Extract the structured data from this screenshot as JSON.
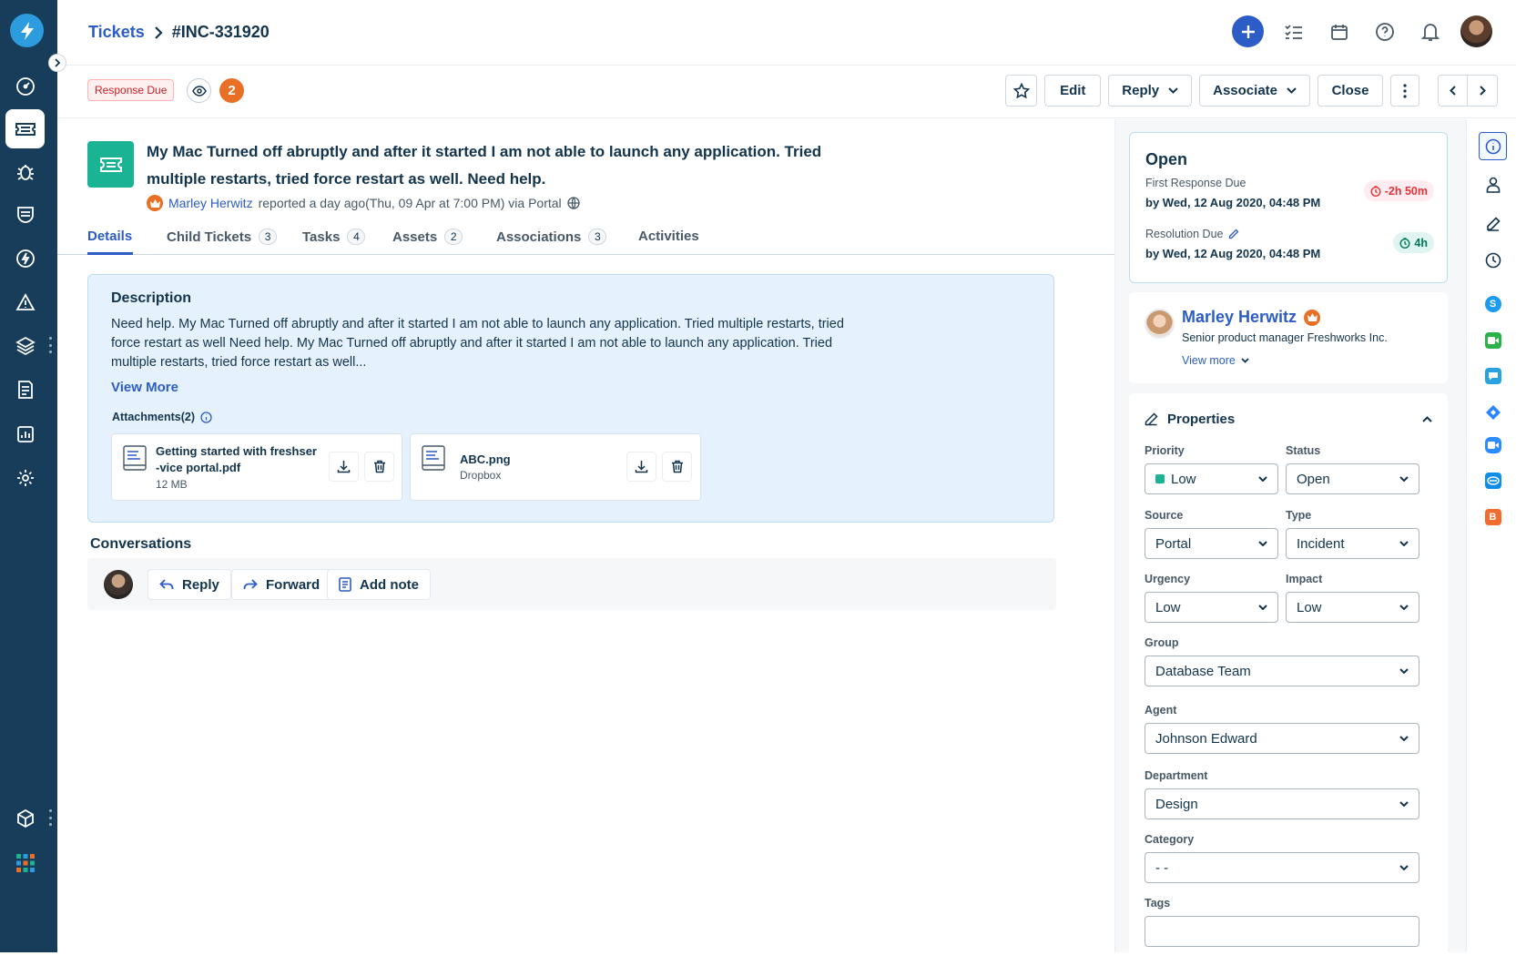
{
  "colors": {
    "brand": "#2c5cc5",
    "sidebar": "#173d5a",
    "ticket_icon": "#1ab394",
    "badge": "#e86f25",
    "due": "#c82124"
  },
  "breadcrumb": {
    "parent": "Tickets",
    "current": "#INC-331920"
  },
  "topbar": {
    "icons": [
      "add-icon",
      "todo-icon",
      "calendar-icon",
      "help-icon",
      "bell-icon",
      "avatar"
    ]
  },
  "status_bar": {
    "due_badge": "Response Due",
    "watchers_count": "2"
  },
  "actions": {
    "edit": "Edit",
    "reply": "Reply",
    "associate": "Associate",
    "close": "Close"
  },
  "ticket": {
    "subject": "My Mac Turned off abruptly and after it started I am not able to launch any application. Tried multiple restarts, tried force restart as well. Need help.",
    "requester": "Marley Herwitz",
    "reported": "reported a day ago(Thu, 09 Apr at 7:00 PM) via Portal"
  },
  "tabs": [
    {
      "label": "Details",
      "count": null
    },
    {
      "label": "Child Tickets",
      "count": "3"
    },
    {
      "label": "Tasks",
      "count": "4"
    },
    {
      "label": "Assets",
      "count": "2"
    },
    {
      "label": "Associations",
      "count": "3"
    },
    {
      "label": "Activities",
      "count": null
    }
  ],
  "description": {
    "title": "Description",
    "text": "Need help. My Mac Turned off abruptly and after it started I am not able to launch any application. Tried multiple restarts, tried force restart as well Need help. My Mac Turned off abruptly and after it started I am not able to launch any application. Tried multiple restarts, tried force restart as well...",
    "view_more": "View More",
    "attachments_label": "Attachments(2)",
    "attachments": [
      {
        "name_line1": "Getting started with freshser",
        "name_line2": "-vice portal.pdf",
        "sub": "12 MB"
      },
      {
        "name_line1": "ABC.png",
        "name_line2": "",
        "sub": "Dropbox"
      }
    ]
  },
  "conversations": {
    "title": "Conversations",
    "reply": "Reply",
    "forward": "Forward",
    "add_note": "Add note"
  },
  "sla": {
    "status": "Open",
    "first_response_label": "First Response Due",
    "first_response_value": "by Wed, 12 Aug 2020, 04:48 PM",
    "first_response_timer": "-2h 50m",
    "resolution_label": "Resolution Due",
    "resolution_value": "by Wed, 12 Aug 2020, 04:48 PM",
    "resolution_timer": "4h"
  },
  "requester_card": {
    "name": "Marley Herwitz",
    "role": "Senior product manager Freshworks Inc.",
    "view_more": "View more"
  },
  "properties": {
    "title": "Properties",
    "priority": {
      "label": "Priority",
      "value": "Low"
    },
    "status": {
      "label": "Status",
      "value": "Open"
    },
    "source": {
      "label": "Source",
      "value": "Portal"
    },
    "type": {
      "label": "Type",
      "value": "Incident"
    },
    "urgency": {
      "label": "Urgency",
      "value": "Low"
    },
    "impact": {
      "label": "Impact",
      "value": "Low"
    },
    "group": {
      "label": "Group",
      "value": "Database Team"
    },
    "agent": {
      "label": "Agent",
      "value": "Johnson Edward"
    },
    "department": {
      "label": "Department",
      "value": "Design"
    },
    "category": {
      "label": "Category",
      "value": "- -"
    },
    "tags": {
      "label": "Tags"
    }
  },
  "right_rail": [
    "info-icon",
    "contact-icon",
    "edit-icon",
    "time-icon",
    "skype-app-icon",
    "video-app-icon",
    "chat-app-icon",
    "jira-app-icon",
    "zoom-app-icon",
    "teamviewer-app-icon",
    "brand-app-icon"
  ],
  "sidebar": [
    "dashboard-icon",
    "tickets-icon",
    "problems-icon",
    "changes-icon",
    "releases-icon",
    "alerts-icon",
    "assets-icon",
    "solutions-icon",
    "reports-icon",
    "admin-icon",
    "apps-icon",
    "grid-icon"
  ]
}
